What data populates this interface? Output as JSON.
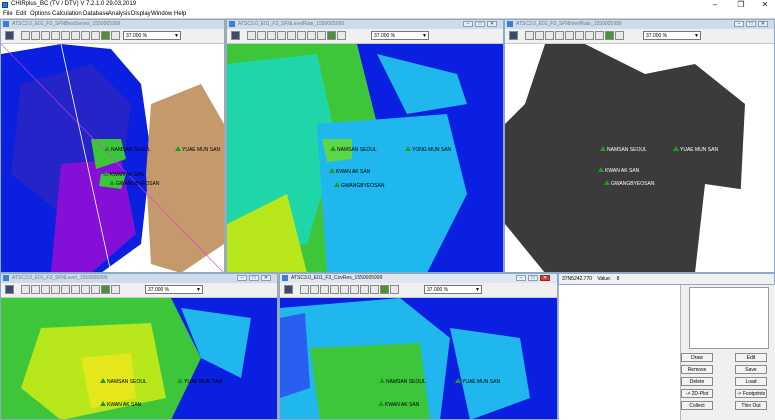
{
  "app": {
    "title": "CHIRplus_BC (TV / DTV)  V 7.2.1.0  29.03.2019",
    "minimize": "–",
    "maximize": "❐",
    "close": "✕"
  },
  "menu": [
    "File",
    "Edit",
    "Options",
    "Calculation",
    "Database",
    "Analysis",
    "Display",
    "Window",
    "Help"
  ],
  "windows": [
    {
      "title": "ATSC3.0_E01_F3_SFNBestServer_1550005999",
      "zoom": "37.000 %",
      "labels": [
        "NAMSAN SEOUL",
        "YUAE MUN SAN",
        "KWAN AK SAN",
        "GWANGBYEOSAN"
      ]
    },
    {
      "title": "ATSC3.0_E01_F3_SFNLevelRate_1550005999",
      "zoom": "37.000 %",
      "labels": [
        "NAMSAN SEOUL",
        "YONG MUN SAN",
        "KWAN AK SAN",
        "GWANGBYEOSAN"
      ]
    },
    {
      "title": "ATSC3.0_E01_F3_SFNInterfRate_1550005999",
      "zoom": "37.000 %",
      "labels": [
        "NAMSAN SEOUL",
        "YUAE MUN SAN",
        "KWAN AK SAN",
        "GWANGBYEOSAN"
      ]
    },
    {
      "title": "ATSC3.0_E01_F3_SFNLevel_1550005999",
      "zoom": "37.000 %",
      "labels": [
        "NAMSAN SEOUL",
        "YUAE MUN SAN",
        "KWAN AK SAN"
      ]
    },
    {
      "title": "ATSC3.0_E01_F3_CovRes_1550005999",
      "zoom": "37.000 %",
      "labels": [
        "NAMSAN SEOUL",
        "YUAE MUN SAN",
        "KWAN AK SAN"
      ]
    }
  ],
  "status": {
    "coords": "37N5242.770",
    "value_label": "Value:",
    "value": "8"
  },
  "buttons": {
    "draw": "Draw",
    "edit": "Edit",
    "remove": "Remove",
    "save": "Save",
    "delete": "Delete",
    "load": "Load",
    "plot2d": "-> 2D-Plot",
    "footprints": "-> Footprints",
    "collect": "Collect",
    "thin_out": "Thin Out"
  },
  "colors": {
    "map_blue": "#0b1fe0",
    "map_green": "#3ec63a",
    "map_cyan": "#1fb7ee",
    "map_dark": "#3b3b3b",
    "map_tan": "#c4996b",
    "marker_green": "#1e9e1e"
  }
}
